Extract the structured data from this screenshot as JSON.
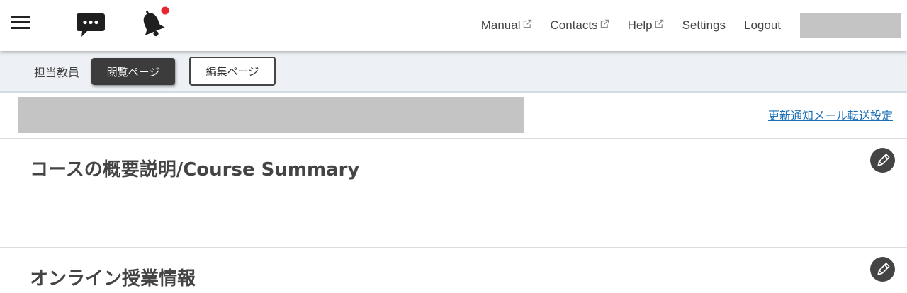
{
  "header": {
    "nav": {
      "manual": "Manual",
      "contacts": "Contacts",
      "help": "Help",
      "settings": "Settings",
      "logout": "Logout"
    },
    "notification_dot_color": "#e8262d"
  },
  "subbar": {
    "role_label": "担当教員",
    "view_button": "閲覧ページ",
    "edit_button": "編集ページ"
  },
  "course": {
    "mail_settings_link": "更新通知メール転送設定"
  },
  "sections": {
    "summary_title": "コースの概要説明/Course Summary",
    "online_title": "オンライン授業情報"
  },
  "colors": {
    "link": "#1a6fb5",
    "dark_button": "#3c3c3c",
    "subbar_bg": "#edf1f5"
  }
}
